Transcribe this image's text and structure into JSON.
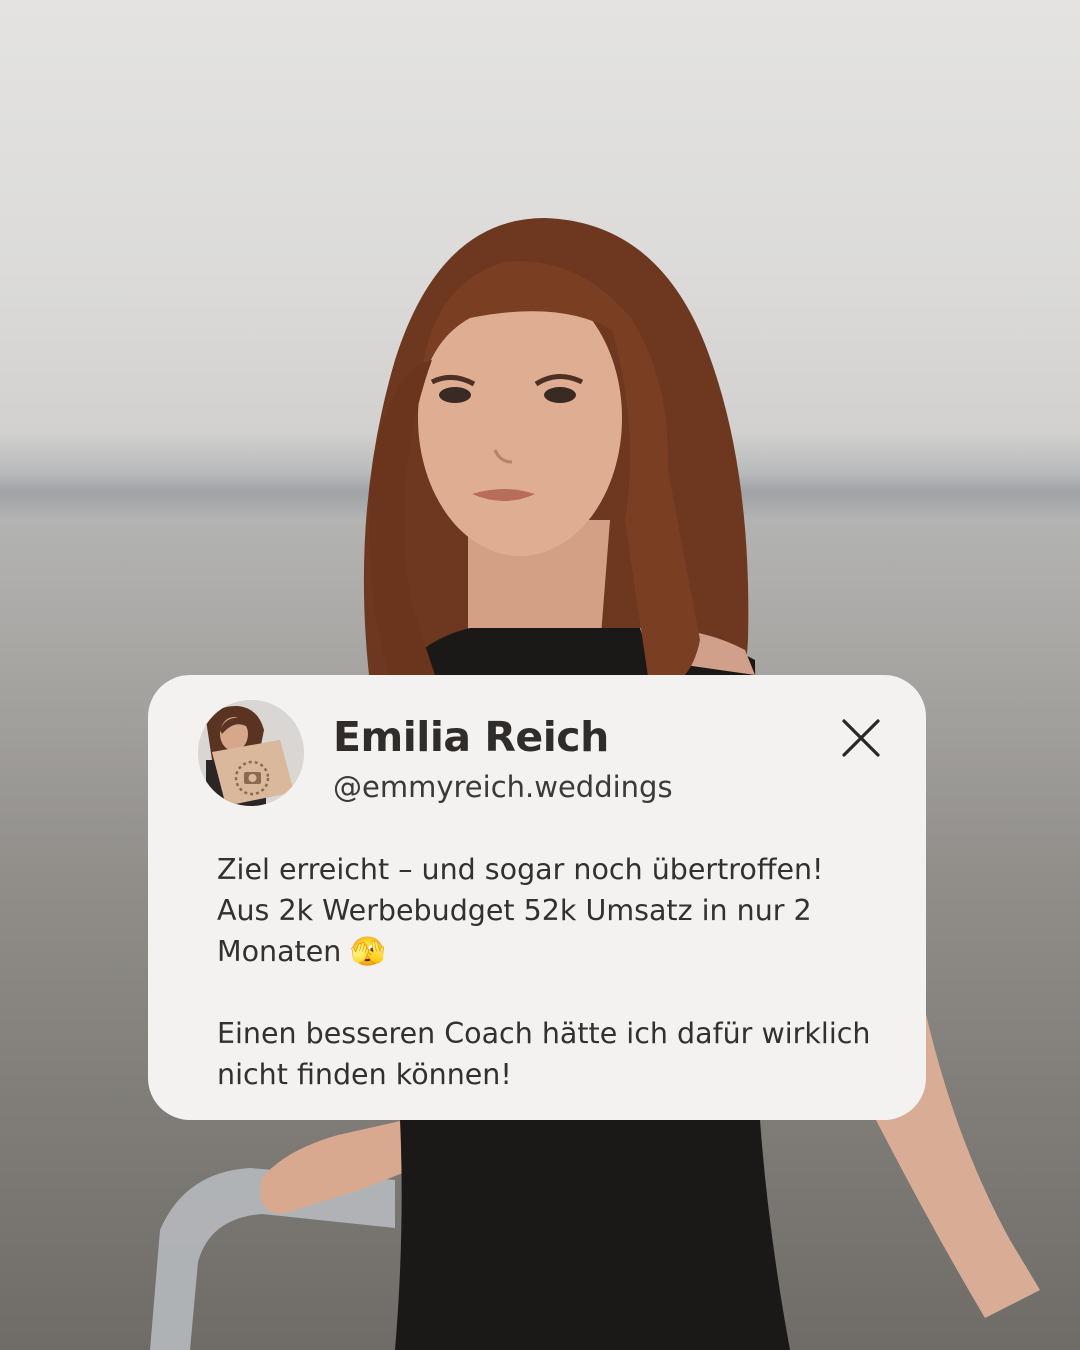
{
  "profile": {
    "name": "Emilia Reich",
    "handle": "@emmyreich.weddings"
  },
  "message": {
    "paragraph_1": "Ziel erreicht – und sogar noch übertroffen! Aus 2k Werbebudget 52k Umsatz in nur 2 Monaten 🫣",
    "paragraph_2": "Einen besseren Coach hätte ich dafür wirklich nicht finden können!"
  },
  "icons": {
    "close": "close-icon",
    "emoji": "face-with-open-eyes-and-hand-over-mouth"
  },
  "colors": {
    "card_background": "#f3f2f0",
    "text": "#33302d",
    "hair": "#7a3f23",
    "top": "#1b1918"
  }
}
